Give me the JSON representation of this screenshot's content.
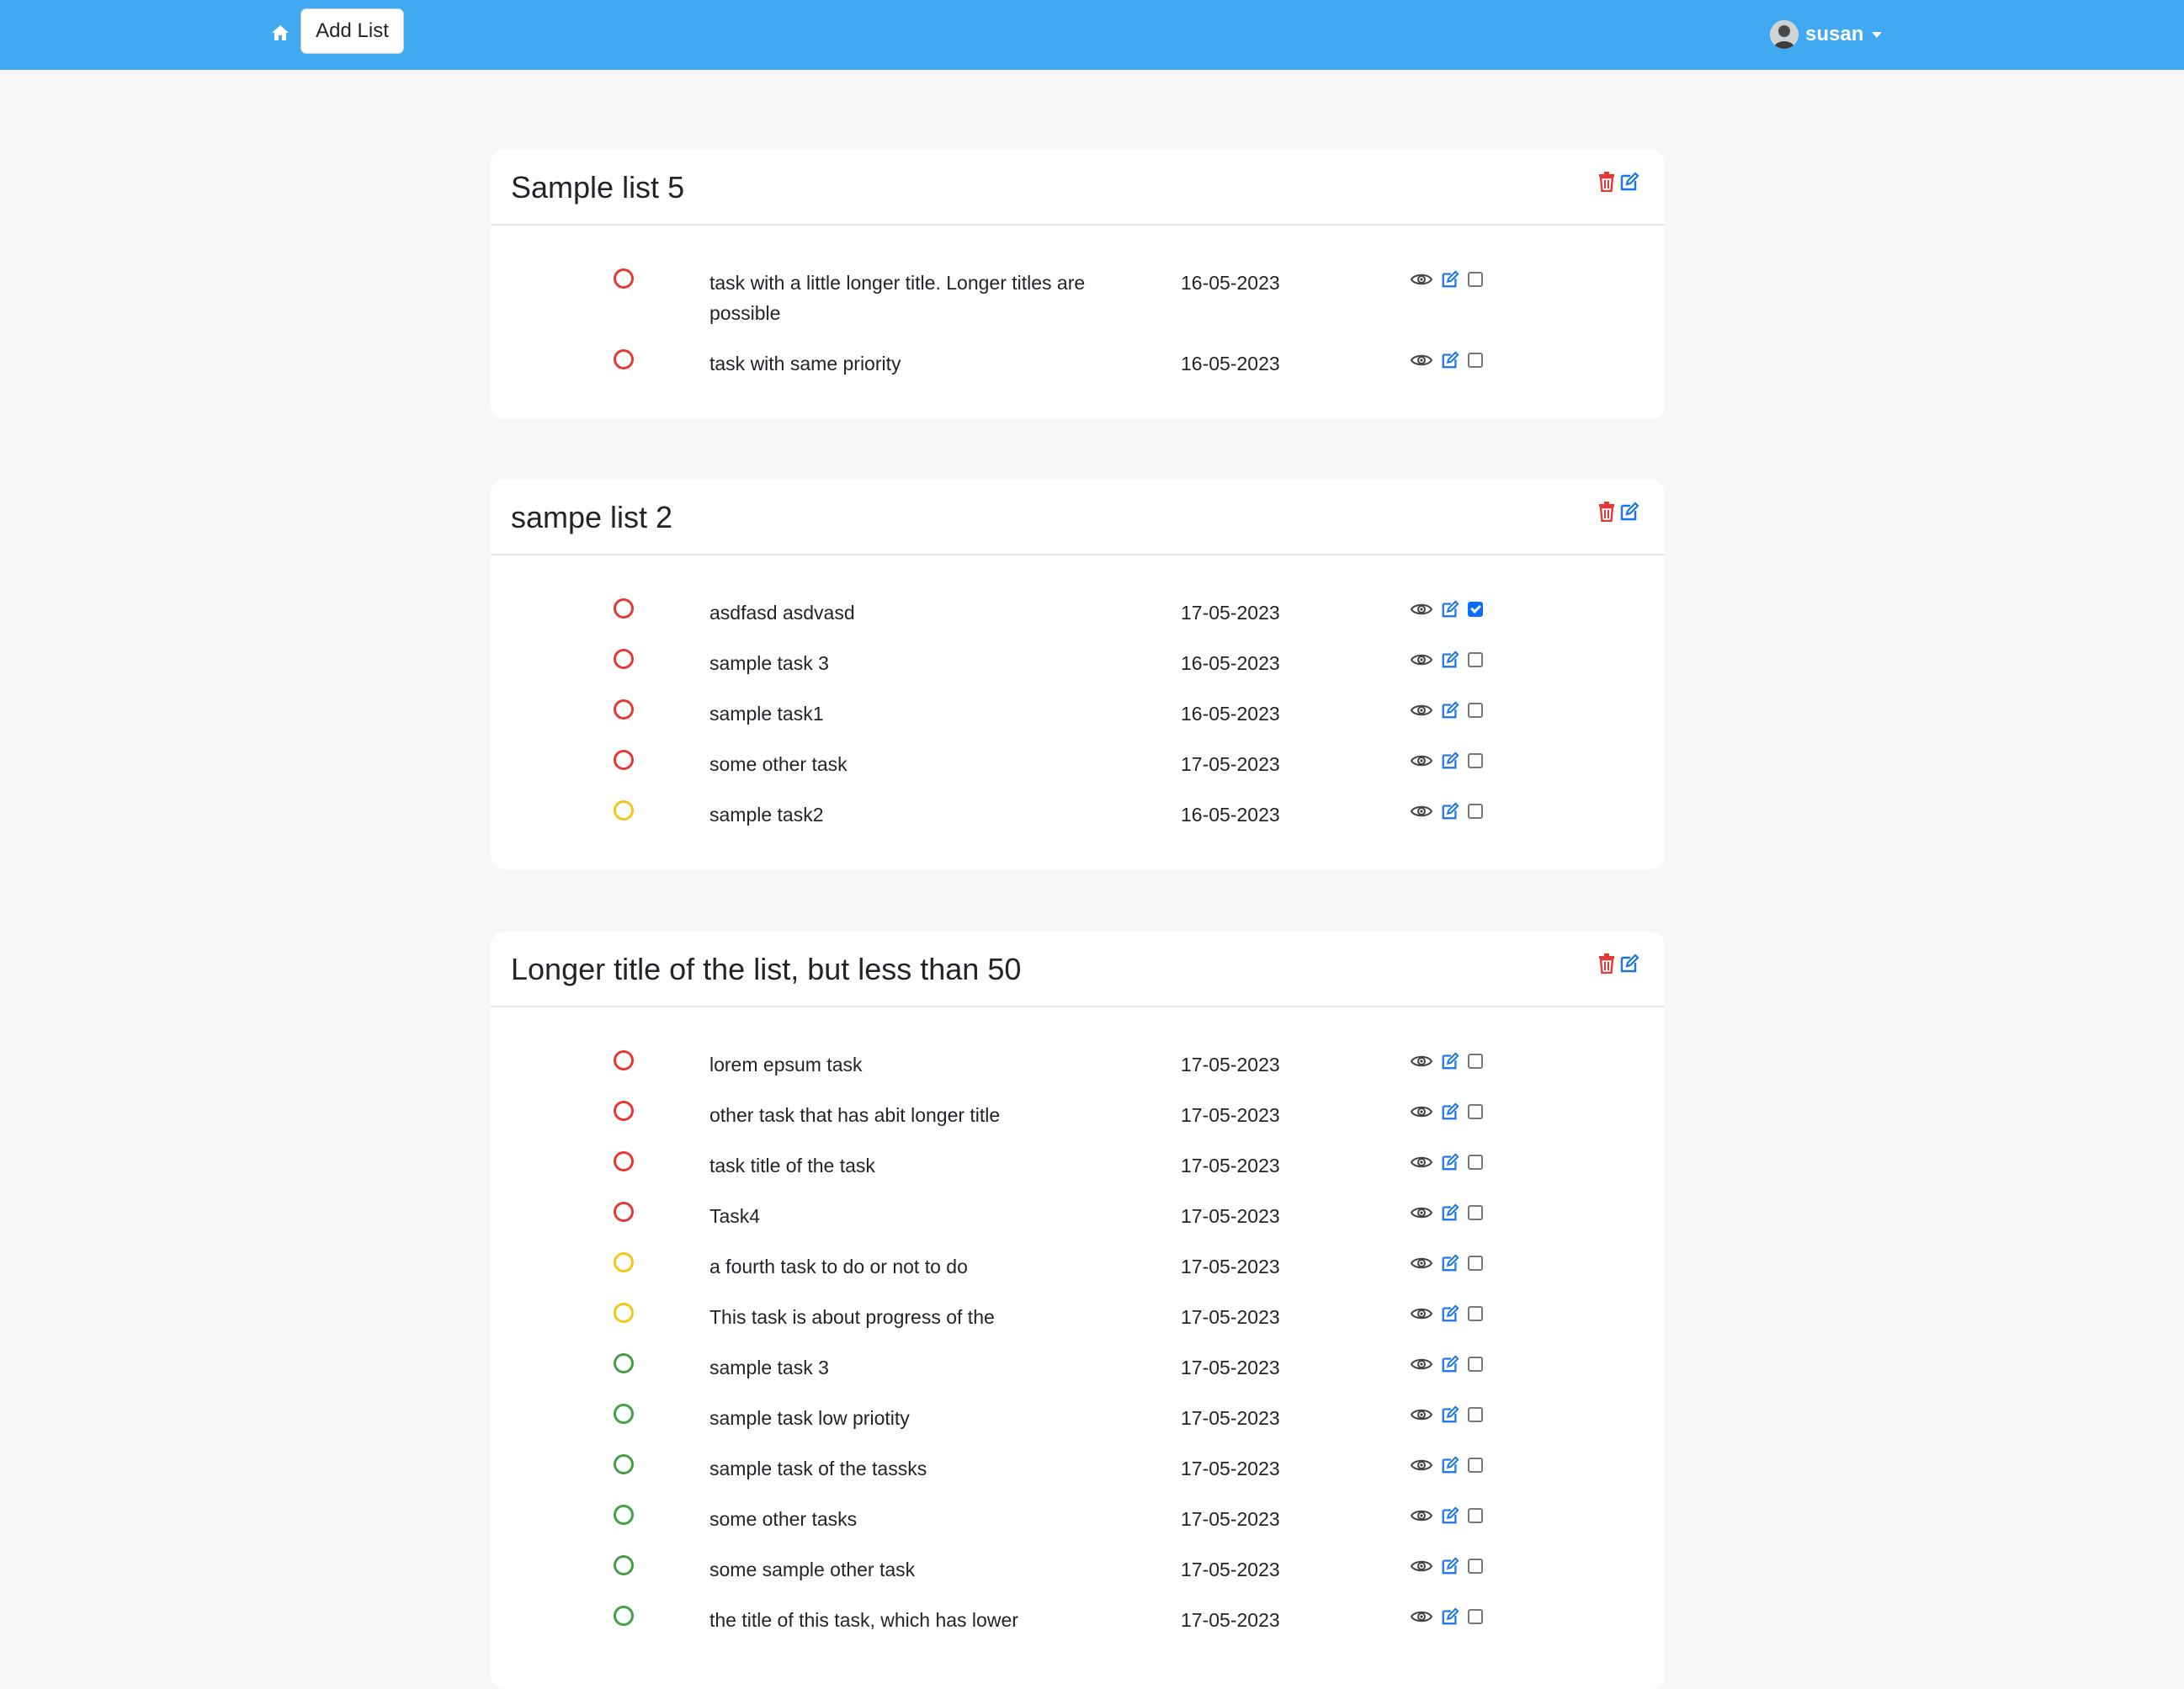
{
  "nav": {
    "add_list_label": "Add List",
    "username": "susan"
  },
  "colors": {
    "navbar": "#41a9f1",
    "priority_high": "#e53935",
    "priority_medium": "#f5c518",
    "priority_low": "#43a047",
    "delete": "#e53935",
    "edit": "#1a73e8"
  },
  "lists": [
    {
      "title": "Sample list 5",
      "tasks": [
        {
          "title": "task with a little longer title. Longer titles are possible",
          "date": "16-05-2023",
          "priority": "high",
          "done": false
        },
        {
          "title": "task with same priority",
          "date": "16-05-2023",
          "priority": "high",
          "done": false
        }
      ]
    },
    {
      "title": "sampe list 2",
      "tasks": [
        {
          "title": "asdfasd asdvasd",
          "date": "17-05-2023",
          "priority": "high",
          "done": true
        },
        {
          "title": "sample task 3",
          "date": "16-05-2023",
          "priority": "high",
          "done": false
        },
        {
          "title": "sample task1",
          "date": "16-05-2023",
          "priority": "high",
          "done": false
        },
        {
          "title": "some other task",
          "date": "17-05-2023",
          "priority": "high",
          "done": false
        },
        {
          "title": "sample task2",
          "date": "16-05-2023",
          "priority": "medium",
          "done": false
        }
      ]
    },
    {
      "title": "Longer title of the list, but less than 50",
      "tasks": [
        {
          "title": "lorem epsum task",
          "date": "17-05-2023",
          "priority": "high",
          "done": false
        },
        {
          "title": "other task that has abit longer title",
          "date": "17-05-2023",
          "priority": "high",
          "done": false
        },
        {
          "title": "task title of the task",
          "date": "17-05-2023",
          "priority": "high",
          "done": false
        },
        {
          "title": "Task4",
          "date": "17-05-2023",
          "priority": "high",
          "done": false
        },
        {
          "title": "a fourth task to do or not to do",
          "date": "17-05-2023",
          "priority": "medium",
          "done": false
        },
        {
          "title": "This task is about progress of the",
          "date": "17-05-2023",
          "priority": "medium",
          "done": false
        },
        {
          "title": "sample task 3",
          "date": "17-05-2023",
          "priority": "low",
          "done": false
        },
        {
          "title": "sample task low priotity",
          "date": "17-05-2023",
          "priority": "low",
          "done": false
        },
        {
          "title": "sample task of the tassks",
          "date": "17-05-2023",
          "priority": "low",
          "done": false
        },
        {
          "title": "some other tasks",
          "date": "17-05-2023",
          "priority": "low",
          "done": false
        },
        {
          "title": "some sample other task",
          "date": "17-05-2023",
          "priority": "low",
          "done": false
        },
        {
          "title": "the title of this task, which has lower",
          "date": "17-05-2023",
          "priority": "low",
          "done": false
        }
      ]
    }
  ]
}
